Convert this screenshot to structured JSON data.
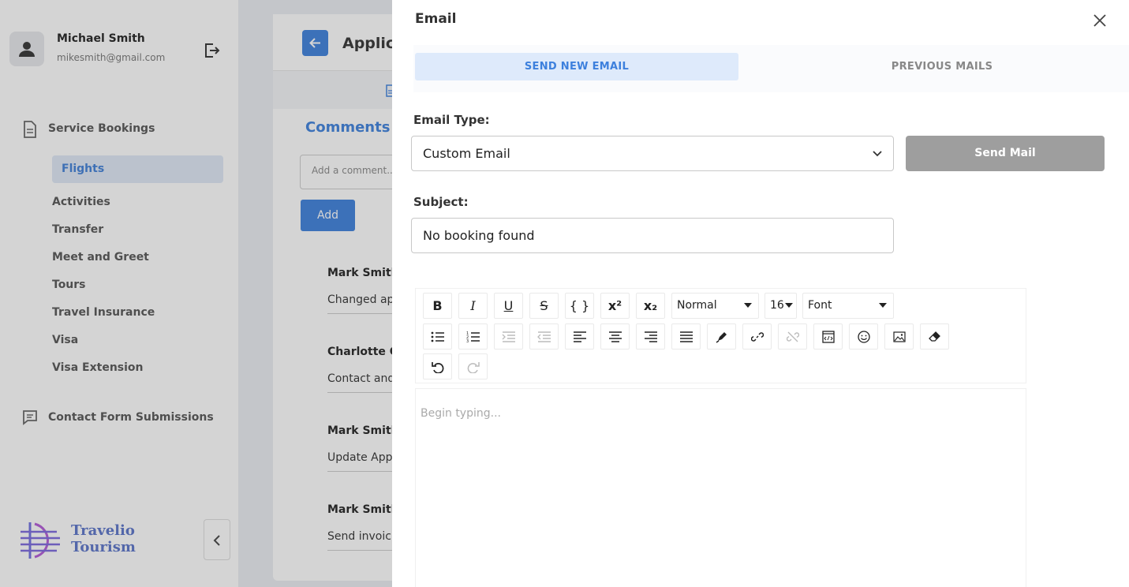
{
  "sidebar": {
    "user": {
      "name": "Michael Smith",
      "email": "mikesmith@gmail.com"
    },
    "groups": [
      {
        "label": "Service Bookings",
        "icon": "document-icon"
      },
      {
        "label": "Contact Form Submissions",
        "icon": "message-icon"
      }
    ],
    "items": [
      {
        "label": "Flights",
        "active": true
      },
      {
        "label": "Activities"
      },
      {
        "label": "Transfer"
      },
      {
        "label": "Meet and Greet"
      },
      {
        "label": "Tours"
      },
      {
        "label": "Travel Insurance"
      },
      {
        "label": "Visa"
      },
      {
        "label": "Visa Extension"
      }
    ],
    "brand": {
      "line1": "Travelio",
      "line2": "Tourism"
    }
  },
  "main": {
    "title": "Applica",
    "comments_heading": "Comments",
    "comment_placeholder": "Add a comment...",
    "add_label": "Add",
    "comments": [
      {
        "author": "Mark Smith",
        "text": "Changed ap"
      },
      {
        "author": "Charlotte G",
        "text": "Contact and"
      },
      {
        "author": "Mark Smith",
        "text": "Update App"
      },
      {
        "author": "Mark Smith",
        "text": "Send invoic"
      }
    ]
  },
  "drawer": {
    "title": "Email",
    "tabs": {
      "new": "SEND NEW EMAIL",
      "previous": "PREVIOUS MAILS"
    },
    "email_type_label": "Email Type:",
    "email_type_value": "Custom Email",
    "send_label": "Send Mail",
    "subject_label": "Subject:",
    "subject_value": "No booking found",
    "toolbar": {
      "format_value": "Normal",
      "size_value": "16",
      "font_value": "Font"
    },
    "editor_placeholder": "Begin typing..."
  },
  "colors": {
    "accent": "#3d80dd",
    "send_disabled": "#9e9e9e",
    "active_tab_bg": "#deeafb"
  }
}
